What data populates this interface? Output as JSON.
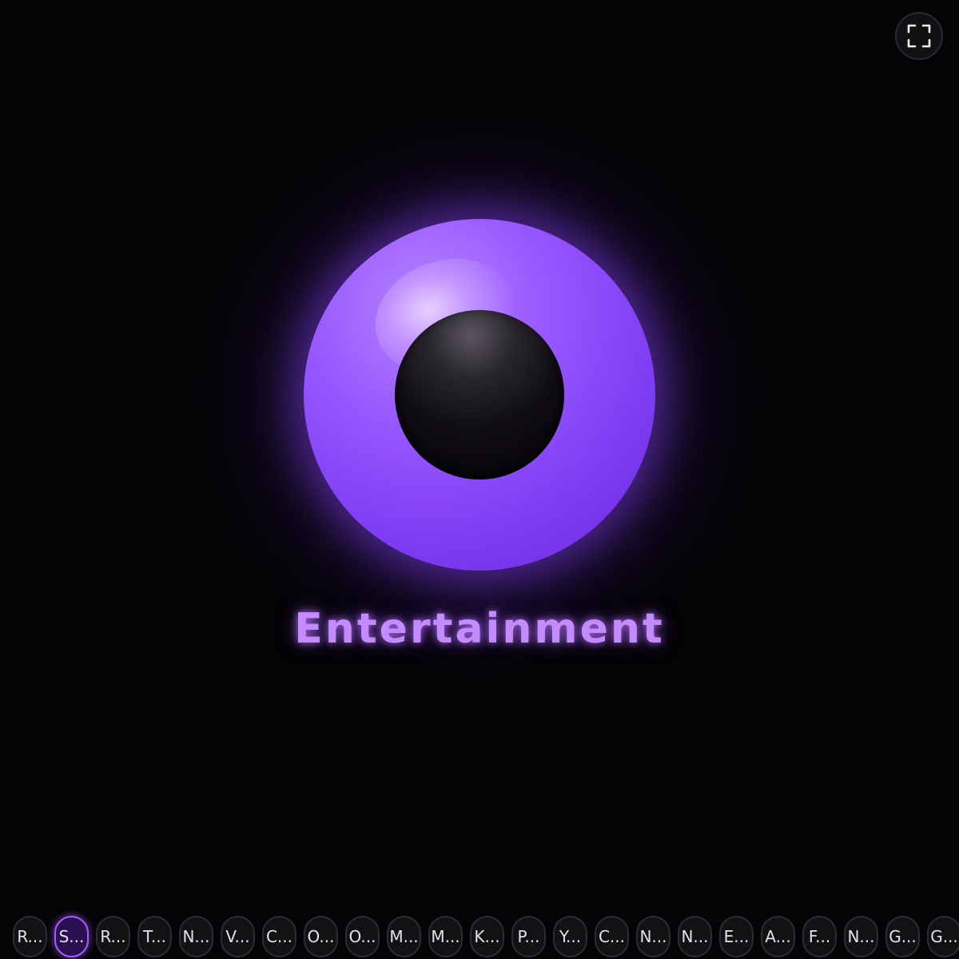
{
  "brand": {
    "name": "Entertainment",
    "accent_color": "#9757ff",
    "text_color": "#c48bff"
  },
  "controls": {
    "fullscreen_icon": "fullscreen-icon"
  },
  "chips": {
    "active_index": 1,
    "items": [
      {
        "label": "R..."
      },
      {
        "label": "S..."
      },
      {
        "label": "R..."
      },
      {
        "label": "T..."
      },
      {
        "label": "N..."
      },
      {
        "label": "V..."
      },
      {
        "label": "C..."
      },
      {
        "label": "O..."
      },
      {
        "label": "O..."
      },
      {
        "label": "M..."
      },
      {
        "label": "M..."
      },
      {
        "label": "K..."
      },
      {
        "label": "P..."
      },
      {
        "label": "Y..."
      },
      {
        "label": "C..."
      },
      {
        "label": "N..."
      },
      {
        "label": "N..."
      },
      {
        "label": "E..."
      },
      {
        "label": "A..."
      },
      {
        "label": "F..."
      },
      {
        "label": "N..."
      },
      {
        "label": "G..."
      },
      {
        "label": "G..."
      }
    ]
  }
}
